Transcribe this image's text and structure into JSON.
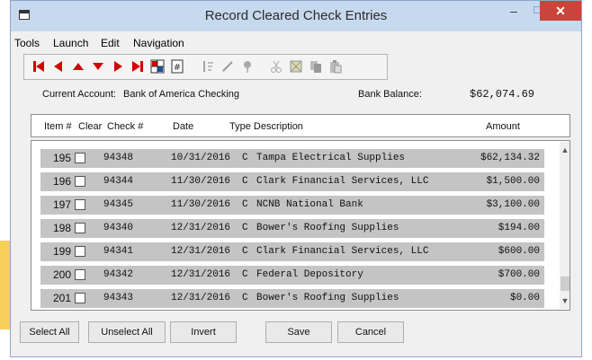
{
  "window": {
    "title": "Record Cleared Check Entries"
  },
  "menu": [
    "Tools",
    "Launch",
    "Edit",
    "Navigation"
  ],
  "toolbar": {
    "buttons": [
      "first-record-icon",
      "previous-record-icon",
      "up-icon",
      "down-icon",
      "next-record-icon",
      "last-record-icon",
      "grid-icon",
      "calculator-icon",
      "sort-icon",
      "edit-icon",
      "pin-icon",
      "cut-icon",
      "select-icon",
      "copy-icon",
      "paste-icon"
    ],
    "accent_color": "#d40000"
  },
  "account": {
    "label": "Current Account:",
    "value": "Bank of America Checking",
    "balance_label": "Bank Balance:",
    "balance_value": "$62,074.69"
  },
  "columns": {
    "item": "Item #",
    "clear": "Clear",
    "check": "Check #",
    "date": "Date",
    "type_description": "Type Description",
    "amount": "Amount"
  },
  "rows": [
    {
      "item": "195",
      "check": "94348",
      "date": "10/31/2016",
      "type": "C",
      "description": "Tampa Electrical Supplies",
      "amount": "$62,134.32",
      "cleared": false
    },
    {
      "item": "196",
      "check": "94344",
      "date": "11/30/2016",
      "type": "C",
      "description": "Clark Financial Services, LLC",
      "amount": "$1,500.00",
      "cleared": false
    },
    {
      "item": "197",
      "check": "94345",
      "date": "11/30/2016",
      "type": "C",
      "description": "NCNB National Bank",
      "amount": "$3,100.00",
      "cleared": false
    },
    {
      "item": "198",
      "check": "94340",
      "date": "12/31/2016",
      "type": "C",
      "description": "Bower's Roofing Supplies",
      "amount": "$194.00",
      "cleared": false
    },
    {
      "item": "199",
      "check": "94341",
      "date": "12/31/2016",
      "type": "C",
      "description": "Clark Financial Services, LLC",
      "amount": "$600.00",
      "cleared": false
    },
    {
      "item": "200",
      "check": "94342",
      "date": "12/31/2016",
      "type": "C",
      "description": "Federal Depository",
      "amount": "$700.00",
      "cleared": false
    },
    {
      "item": "201",
      "check": "94343",
      "date": "12/31/2016",
      "type": "C",
      "description": "Bower's Roofing Supplies",
      "amount": "$0.00",
      "cleared": false
    }
  ],
  "buttons": {
    "select_all": "Select All",
    "unselect_all": "Unselect All",
    "invert": "Invert",
    "save": "Save",
    "cancel": "Cancel"
  }
}
